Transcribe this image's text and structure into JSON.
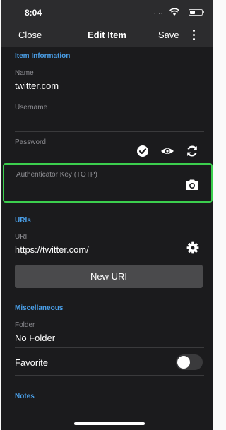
{
  "status_bar": {
    "time": "8:04",
    "signal": "....",
    "wifi_icon": "wifi-icon",
    "battery_icon": "battery-icon"
  },
  "nav": {
    "close_label": "Close",
    "title": "Edit Item",
    "save_label": "Save",
    "more_icon": "vertical-ellipsis-icon"
  },
  "item_information": {
    "header": "Item Information",
    "name_label": "Name",
    "name_value": "twitter.com",
    "username_label": "Username",
    "username_value": "",
    "password_label": "Password",
    "password_value": "",
    "password_icons": [
      "check-circle-icon",
      "eye-icon",
      "refresh-icon"
    ],
    "totp_label": "Authenticator Key (TOTP)",
    "totp_value": "",
    "totp_icon": "camera-icon"
  },
  "uris": {
    "header": "URIs",
    "uri_label": "URI",
    "uri_value": "https://twitter.com/",
    "settings_icon": "gear-icon",
    "new_uri_label": "New URI"
  },
  "miscellaneous": {
    "header": "Miscellaneous",
    "folder_label": "Folder",
    "folder_value": "No Folder",
    "favorite_label": "Favorite",
    "favorite_on": false
  },
  "notes": {
    "header": "Notes"
  },
  "colors": {
    "background": "#1b1b1d",
    "bar": "#2c2c2e",
    "accent": "#4a9fe8",
    "highlight": "#3ccf4e",
    "button": "#4a4a4c"
  }
}
